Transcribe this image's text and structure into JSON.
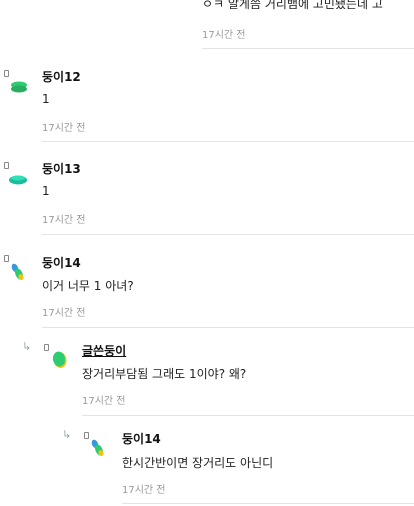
{
  "comments": [
    {
      "text": "ㅇㅋ 알게씀 거리뱀에 고민됐는데 고",
      "time": "17시간 전"
    },
    {
      "author": "둥이12",
      "text": "1",
      "time": "17시간 전"
    },
    {
      "author": "둥이13",
      "text": "1",
      "time": "17시간 전"
    },
    {
      "author": "둥이14",
      "text": "이거 너무 1 아녀?",
      "time": "17시간 전"
    }
  ],
  "replies": [
    {
      "author": "글쓴둥이",
      "text": "장거리부담됨 그래도 1이야? 왜?",
      "time": "17시간 전"
    },
    {
      "author": "둥이14",
      "text": "한시간반이면 장거리도 아닌디",
      "time": "17시간 전"
    }
  ],
  "icons": {
    "avatar": "green-blob-avatar",
    "reply": "reply-arrow-icon"
  },
  "colors": {
    "avatar_green": "#2ecc71",
    "avatar_teal": "#1abc9c",
    "avatar_blue": "#3498db",
    "avatar_yellow": "#f1c40f"
  }
}
